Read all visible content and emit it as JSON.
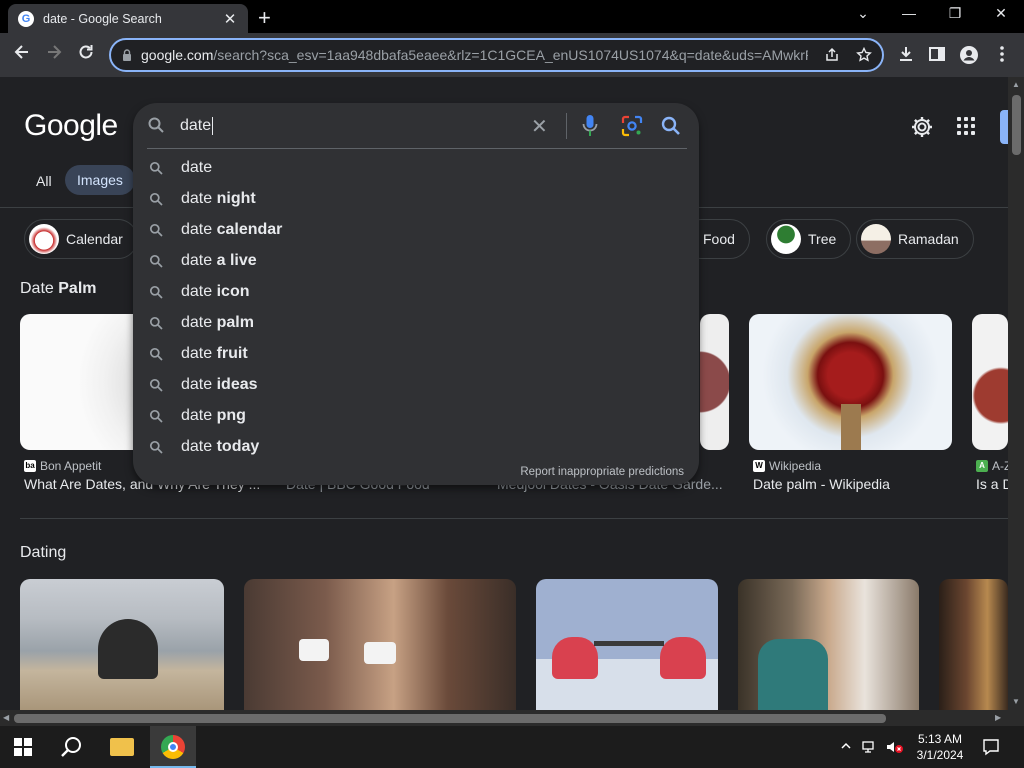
{
  "browser": {
    "tab_title": "date - Google Search",
    "tab_favicon": "G",
    "url_host": "google.com",
    "url_rest": "/search?sca_esv=1aa948dbafa5eaee&rlz=1C1GCEA_enUS1074US1074&q=date&uds=AMwkrP...",
    "new_tab_glyph": "+",
    "close_glyph": "✕",
    "win_controls": [
      "⌄",
      "—",
      "❐",
      "✕"
    ]
  },
  "page": {
    "logo": "Google",
    "filters": {
      "all": "All",
      "images": "Images"
    },
    "chips": [
      {
        "label": "Calendar"
      },
      {
        "label": "Food"
      },
      {
        "label": "Tree"
      },
      {
        "label": "Ramadan"
      }
    ],
    "section1": {
      "prefix": "Date ",
      "bold": "Palm"
    },
    "cards": [
      {
        "source": "Bon Appetit",
        "badge": "ba",
        "title": "What Are Dates, and Why Are They ..."
      },
      {
        "source": "",
        "badge": "",
        "title": "Date | BBC Good Food"
      },
      {
        "source": "",
        "badge": "",
        "title": "Medjool Dates - Oasis Date Garde..."
      },
      {
        "source": "Wikipedia",
        "badge": "W",
        "title": "Date palm - Wikipedia"
      },
      {
        "source": "A-Z",
        "badge": "A",
        "title": "Is a D"
      }
    ],
    "section2": "Dating"
  },
  "search": {
    "query": "date",
    "suggestions": [
      {
        "base": "date",
        "bold": ""
      },
      {
        "base": "date ",
        "bold": "night"
      },
      {
        "base": "date ",
        "bold": "calendar"
      },
      {
        "base": "date ",
        "bold": "a live"
      },
      {
        "base": "date ",
        "bold": "icon"
      },
      {
        "base": "date ",
        "bold": "palm"
      },
      {
        "base": "date ",
        "bold": "fruit"
      },
      {
        "base": "date ",
        "bold": "ideas"
      },
      {
        "base": "date ",
        "bold": "png"
      },
      {
        "base": "date ",
        "bold": "today"
      }
    ],
    "report": "Report inappropriate predictions"
  },
  "taskbar": {
    "time": "5:13 AM",
    "date": "3/1/2024"
  },
  "colors": {
    "accent": "#8ab4f8",
    "background": "#202124",
    "dropdown": "#303134"
  }
}
